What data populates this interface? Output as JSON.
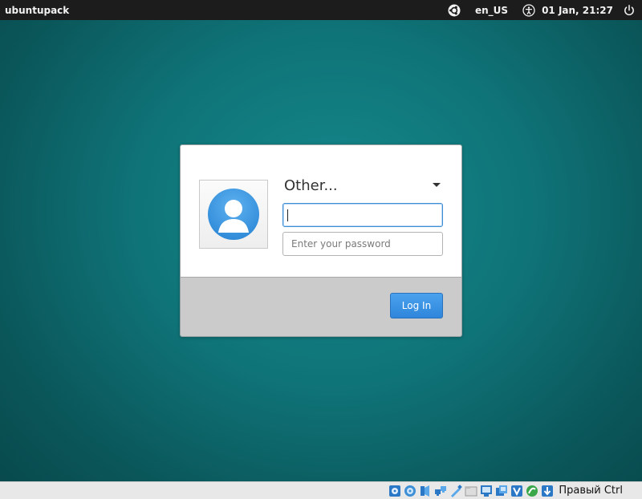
{
  "top_panel": {
    "hostname": "ubuntupack",
    "keyboard_layout": "en_US",
    "datetime": "01 Jan, 21:27",
    "icons": [
      "ubuntu-logo-icon",
      "accessibility-icon",
      "power-icon"
    ]
  },
  "login": {
    "user_selector": "Other...",
    "username_value": "",
    "password_placeholder": "Enter your password",
    "login_button": "Log In"
  },
  "status_bar": {
    "host_key_label": "Правый Ctrl",
    "icons": [
      "hard-disk-icon",
      "optical-drive-icon",
      "audio-icon",
      "network-icon",
      "usb-icon",
      "shared-folders-icon",
      "display-icon",
      "video-capture-icon",
      "virtualization-icon",
      "mouse-integration-icon",
      "host-key-arrow-icon"
    ]
  },
  "colors": {
    "desktop_bg": "#0f7377",
    "panel_bg": "#1c1c1c",
    "accent": "#2f86db"
  }
}
